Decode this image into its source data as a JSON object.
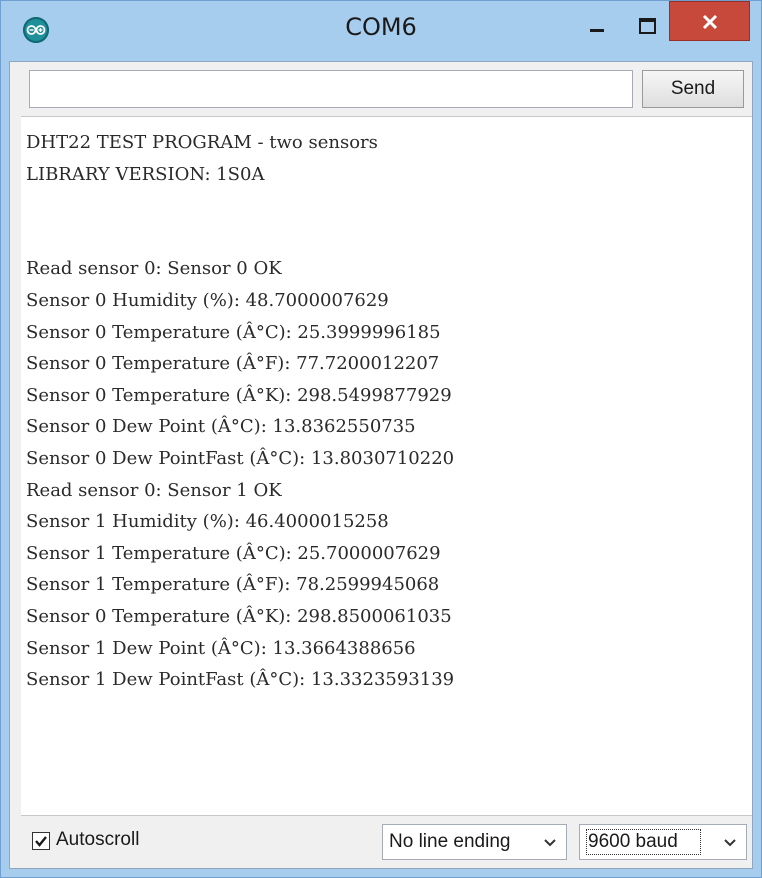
{
  "window": {
    "title": "COM6"
  },
  "input": {
    "value": "",
    "placeholder": ""
  },
  "send_label": "Send",
  "console": {
    "lines": [
      "DHT22 TEST PROGRAM - two sensors",
      "LIBRARY VERSION: 1S0A",
      "",
      "",
      "Read sensor 0: Sensor 0 OK",
      "Sensor 0 Humidity (%): 48.7000007629",
      "Sensor 0 Temperature (Â°C): 25.3999996185",
      "Sensor 0 Temperature (Â°F): 77.7200012207",
      "Sensor 0 Temperature (Â°K): 298.5499877929",
      "Sensor 0 Dew Point (Â°C): 13.8362550735",
      "Sensor 0 Dew PointFast (Â°C): 13.8030710220",
      "Read sensor 0: Sensor 1 OK",
      "Sensor 1 Humidity (%): 46.4000015258",
      "Sensor 1 Temperature (Â°C): 25.7000007629",
      "Sensor 1 Temperature (Â°F): 78.2599945068",
      "Sensor 0 Temperature (Â°K): 298.8500061035",
      "Sensor 1 Dew Point (Â°C): 13.3664388656",
      "Sensor 1 Dew PointFast (Â°C): 13.3323593139"
    ]
  },
  "footer": {
    "autoscroll_label": "Autoscroll",
    "autoscroll_checked": true,
    "line_ending": "No line ending",
    "baud": "9600 baud"
  },
  "icons": {
    "app": "arduino-icon",
    "minimize": "minimize-icon",
    "maximize": "maximize-icon",
    "close": "close-icon",
    "check": "check-icon",
    "dropdown": "chevron-down-icon"
  },
  "colors": {
    "titlebar": "#a7cdee",
    "close": "#c7493c",
    "panel": "#f0f0f0",
    "console_bg": "#ffffff",
    "console_text": "#2a2a2a"
  }
}
